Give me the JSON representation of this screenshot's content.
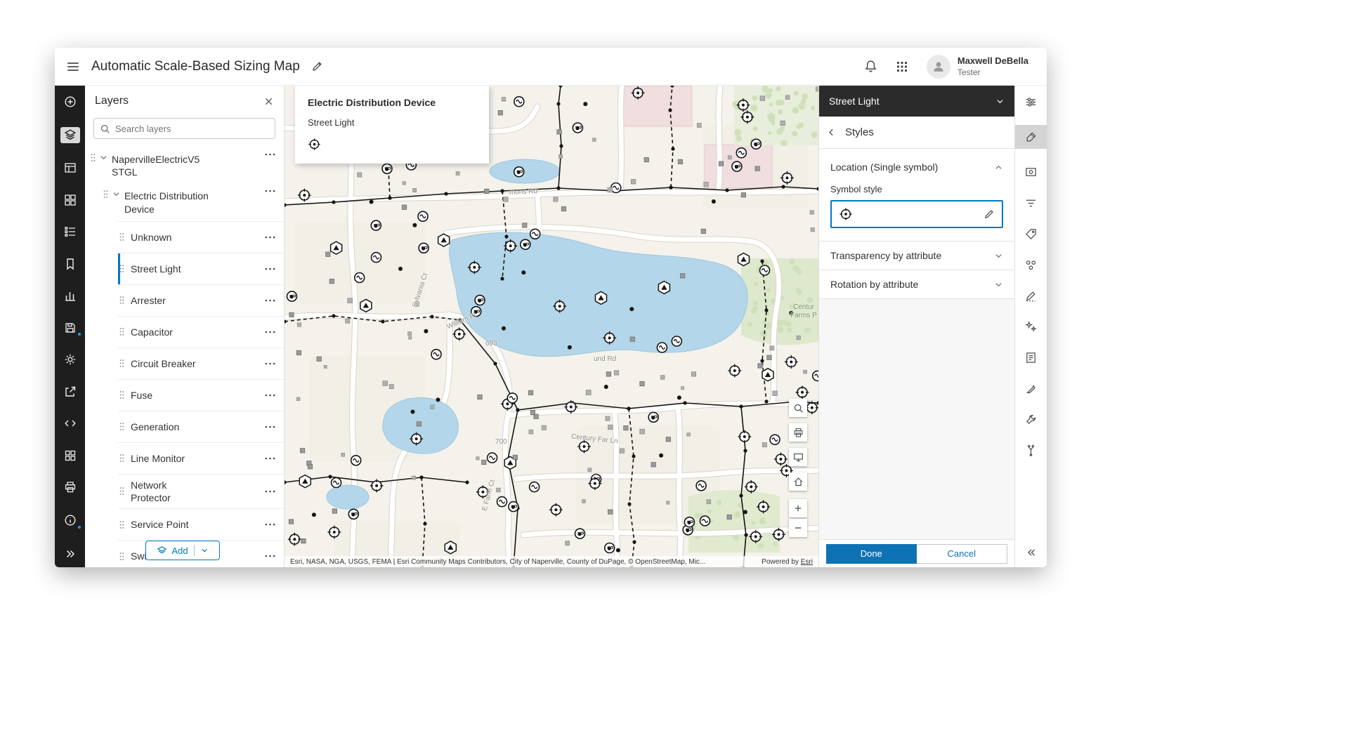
{
  "header": {
    "title": "Automatic Scale-Based Sizing Map",
    "user_name": "Maxwell DeBella",
    "user_role": "Tester"
  },
  "layers_panel": {
    "title": "Layers",
    "search_placeholder": "Search layers",
    "root_layer": "NapervilleElectricV5 STGL",
    "group_layer": "Electric Distribution Device",
    "items": [
      "Unknown",
      "Street Light",
      "Arrester",
      "Capacitor",
      "Circuit Breaker",
      "Fuse",
      "Generation",
      "Line Monitor",
      "Network Protector",
      "Service Point",
      "Switch"
    ],
    "selected_item": "Street Light",
    "add_label": "Add"
  },
  "map": {
    "popup": {
      "title": "Electric Distribution Device",
      "subtitle": "Street Light"
    },
    "road_labels": [
      {
        "text": "mons Rd"
      },
      {
        "text": "Sylvania Ct"
      },
      {
        "text": "William Pl"
      },
      {
        "text": "693"
      },
      {
        "text": "und Rd"
      },
      {
        "text": "700"
      },
      {
        "text": "Century Far Ln"
      },
      {
        "text": "E Farm Ct"
      },
      {
        "text": "Centur"
      },
      {
        "text": "Farms P"
      }
    ],
    "attribution": "Esri, NASA, NGA, USGS, FEMA | Esri Community Maps Contributors, City of Naperville, County of DuPage, © OpenStreetMap, Mic...",
    "powered_by": "Powered by",
    "powered_by_link": "Esri"
  },
  "style_panel": {
    "layer_title": "Street Light",
    "panel_title": "Styles",
    "location_section": "Location (Single symbol)",
    "symbol_style_label": "Symbol style",
    "transparency_section": "Transparency by attribute",
    "rotation_section": "Rotation by attribute",
    "done_label": "Done",
    "cancel_label": "Cancel"
  },
  "icons": {
    "left_toolbar": [
      "add",
      "layers",
      "tables",
      "basemap",
      "legend",
      "bookmarks",
      "charts",
      "save",
      "settings",
      "share",
      "developer",
      "apps",
      "print",
      "info",
      "expand"
    ],
    "right_toolbar": [
      "properties",
      "styles",
      "pop-ups",
      "filter",
      "labels",
      "aggregation",
      "smart-mapping",
      "sketch",
      "edit",
      "effects",
      "configure",
      "trace",
      "collapse"
    ],
    "map_controls": [
      "search",
      "print",
      "presentation",
      "home",
      "zoom-in",
      "zoom-out"
    ]
  },
  "colors": {
    "accent_blue": "#0079c1",
    "done_blue": "#0f72b4",
    "rail_dark": "#1e1e1e",
    "selected_header_dark": "#2b2b2b",
    "water": "#b3d6ea",
    "park_green": "#dde8cc",
    "map_background": "#f4f2eb",
    "notification_dot": "#2e97d4"
  }
}
